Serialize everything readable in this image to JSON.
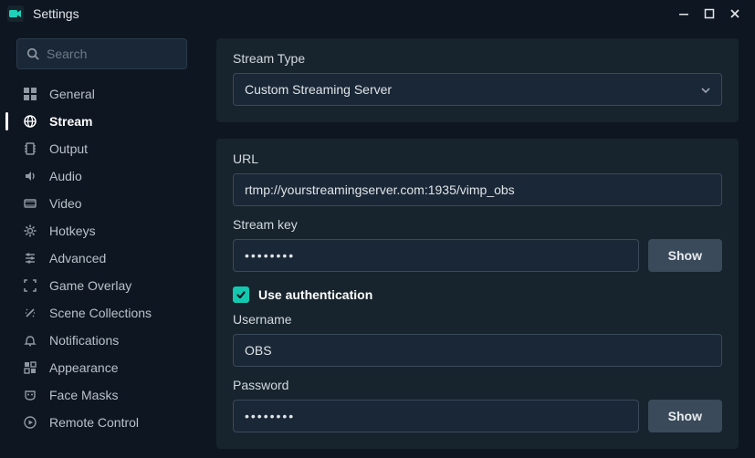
{
  "window": {
    "title": "Settings"
  },
  "search": {
    "placeholder": "Search"
  },
  "sidebar": {
    "items": [
      {
        "label": "General"
      },
      {
        "label": "Stream"
      },
      {
        "label": "Output"
      },
      {
        "label": "Audio"
      },
      {
        "label": "Video"
      },
      {
        "label": "Hotkeys"
      },
      {
        "label": "Advanced"
      },
      {
        "label": "Game Overlay"
      },
      {
        "label": "Scene Collections"
      },
      {
        "label": "Notifications"
      },
      {
        "label": "Appearance"
      },
      {
        "label": "Face Masks"
      },
      {
        "label": "Remote Control"
      }
    ],
    "active_index": 1
  },
  "stream": {
    "type_label": "Stream Type",
    "type_value": "Custom Streaming Server",
    "url_label": "URL",
    "url_value": "rtmp://yourstreamingserver.com:1935/vimp_obs",
    "key_label": "Stream key",
    "key_value": "••••••••",
    "show_button": "Show",
    "auth_checkbox_label": "Use authentication",
    "auth_checked": true,
    "username_label": "Username",
    "username_value": "OBS",
    "password_label": "Password",
    "password_value": "••••••••",
    "password_show_button": "Show"
  }
}
